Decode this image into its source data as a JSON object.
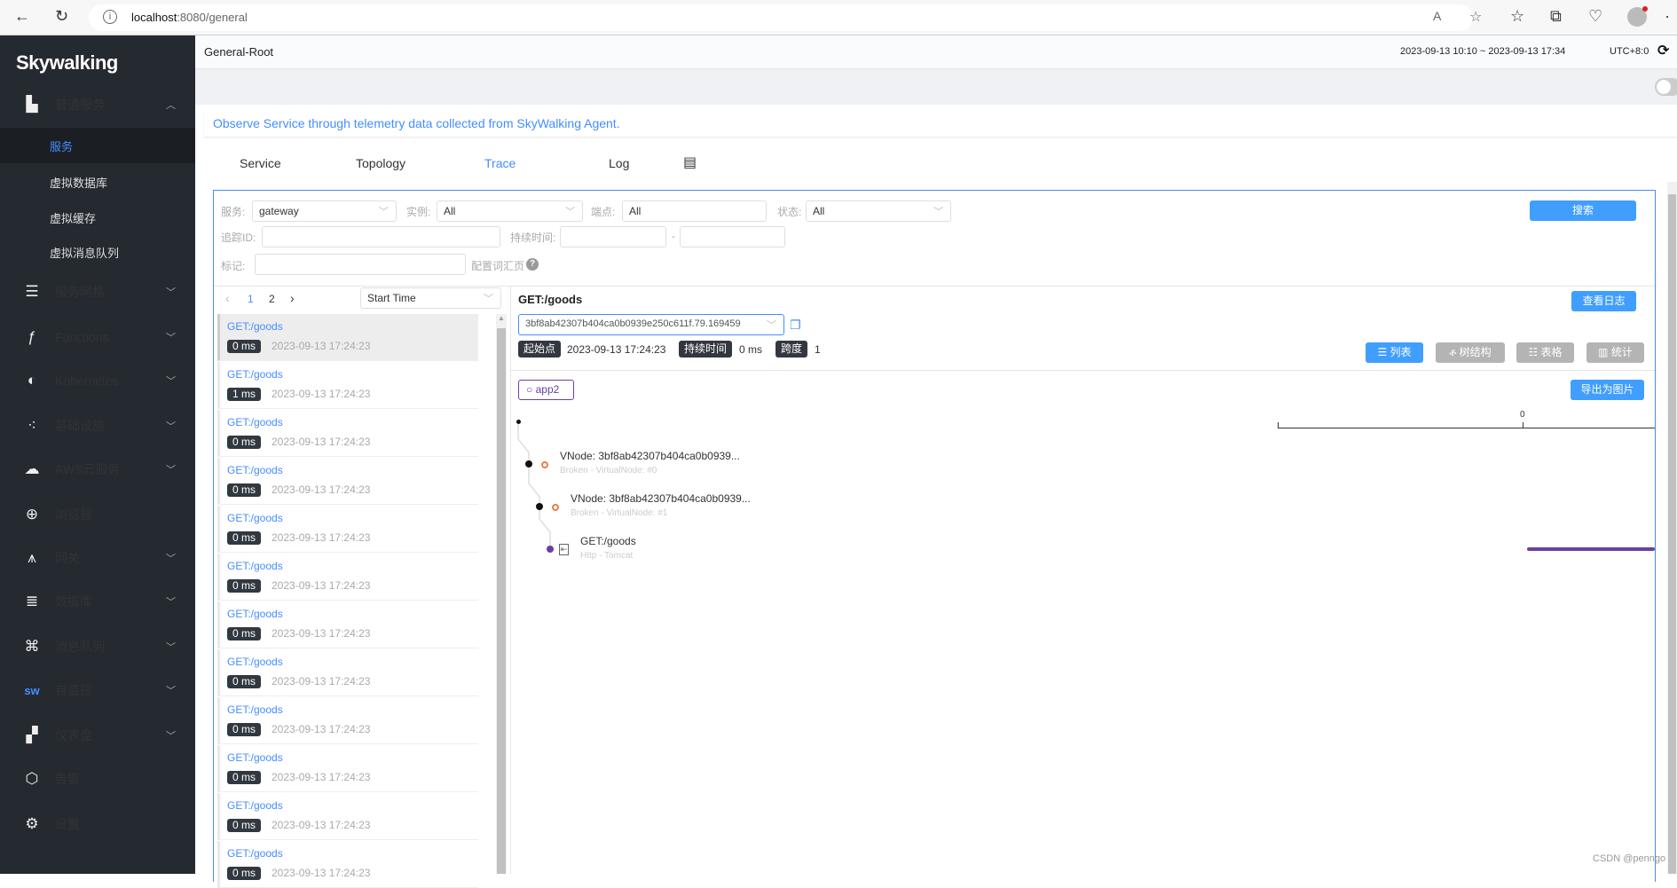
{
  "browser": {
    "url_host": "localhost",
    "url_rest": ":8080/general"
  },
  "sidebar": {
    "logo": "Skywalking",
    "items": [
      {
        "label": "普通服务",
        "icon": "chart-icon",
        "expanded": true
      },
      {
        "label": "服务网格",
        "icon": "mesh-icon"
      },
      {
        "label": "Functions",
        "icon": "function-icon"
      },
      {
        "label": "Kubernetes",
        "icon": "kubernetes-icon"
      },
      {
        "label": "基础设施",
        "icon": "infrastructure-icon"
      },
      {
        "label": "AWS云服务",
        "icon": "cloud-icon"
      },
      {
        "label": "浏览器",
        "icon": "globe-icon"
      },
      {
        "label": "网关",
        "icon": "gateway-icon"
      },
      {
        "label": "数据库",
        "icon": "database-icon"
      },
      {
        "label": "消息队列",
        "icon": "queue-icon"
      },
      {
        "label": "自监控",
        "icon": "sw-icon"
      },
      {
        "label": "仪表盘",
        "icon": "dashboard-icon"
      },
      {
        "label": "告警",
        "icon": "alarm-icon"
      },
      {
        "label": "设置",
        "icon": "gear-icon"
      }
    ],
    "subitems": [
      "服务",
      "虚拟数据库",
      "虚拟缓存",
      "虚拟消息队列"
    ],
    "active_sub": "服务"
  },
  "header": {
    "title": "General-Root",
    "time_range": "2023-09-13 10:10 ~ 2023-09-13 17:34",
    "timezone": "UTC+8:0"
  },
  "description": "Observe Service through telemetry data collected from SkyWalking Agent.",
  "tabs": [
    "Service",
    "Topology",
    "Trace",
    "Log"
  ],
  "active_tab": "Trace",
  "filters": {
    "service_label": "服务:",
    "service_value": "gateway",
    "instance_label": "实例:",
    "instance_value": "All",
    "endpoint_label": "端点:",
    "endpoint_value": "All",
    "status_label": "状态:",
    "status_value": "All",
    "trace_id_label": "追踪ID:",
    "duration_label": "持续时间:",
    "duration_sep": "-",
    "tags_label": "标记:",
    "vocab_link": "配置词汇页",
    "search_button": "搜索"
  },
  "pagination": {
    "prev": "‹",
    "pages": [
      "1",
      "2"
    ],
    "current": "1",
    "next": "›",
    "sort": "Start Time"
  },
  "traces": [
    {
      "name": "GET:/goods",
      "duration": "0 ms",
      "time": "2023-09-13 17:24:23"
    },
    {
      "name": "GET:/goods",
      "duration": "1 ms",
      "time": "2023-09-13 17:24:23"
    },
    {
      "name": "GET:/goods",
      "duration": "0 ms",
      "time": "2023-09-13 17:24:23"
    },
    {
      "name": "GET:/goods",
      "duration": "0 ms",
      "time": "2023-09-13 17:24:23"
    },
    {
      "name": "GET:/goods",
      "duration": "0 ms",
      "time": "2023-09-13 17:24:23"
    },
    {
      "name": "GET:/goods",
      "duration": "0 ms",
      "time": "2023-09-13 17:24:23"
    },
    {
      "name": "GET:/goods",
      "duration": "0 ms",
      "time": "2023-09-13 17:24:23"
    },
    {
      "name": "GET:/goods",
      "duration": "0 ms",
      "time": "2023-09-13 17:24:23"
    },
    {
      "name": "GET:/goods",
      "duration": "0 ms",
      "time": "2023-09-13 17:24:23"
    },
    {
      "name": "GET:/goods",
      "duration": "0 ms",
      "time": "2023-09-13 17:24:23"
    },
    {
      "name": "GET:/goods",
      "duration": "0 ms",
      "time": "2023-09-13 17:24:23"
    },
    {
      "name": "GET:/goods",
      "duration": "0 ms",
      "time": "2023-09-13 17:24:23"
    }
  ],
  "detail": {
    "title": "GET:/goods",
    "trace_id": "3bf8ab42307b404ca0b0939e250c611f.79.169459",
    "start_label": "起始点",
    "start_value": "2023-09-13 17:24:23",
    "duration_label": "持续时间",
    "duration_value": "0 ms",
    "span_label": "跨度",
    "span_value": "1",
    "view_logs": "查看日志",
    "views": [
      "列表",
      "树结构",
      "表格",
      "统计"
    ],
    "active_view": "列表",
    "service_tag": "app2",
    "export": "导出为图片",
    "axis_tick": "0",
    "spans": [
      {
        "title": "VNode: 3bf8ab42307b404ca0b0939...",
        "sub": "Broken - VirtualNode: #0"
      },
      {
        "title": "VNode: 3bf8ab42307b404ca0b0939...",
        "sub": "Broken - VirtualNode: #1"
      },
      {
        "title": "GET:/goods",
        "sub": "Http - Tomcat"
      }
    ],
    "bar_color": "#6b3fa0"
  },
  "watermark": "CSDN @penngo",
  "colors": {
    "accent": "#448dfe",
    "sidebar": "#252a31"
  }
}
